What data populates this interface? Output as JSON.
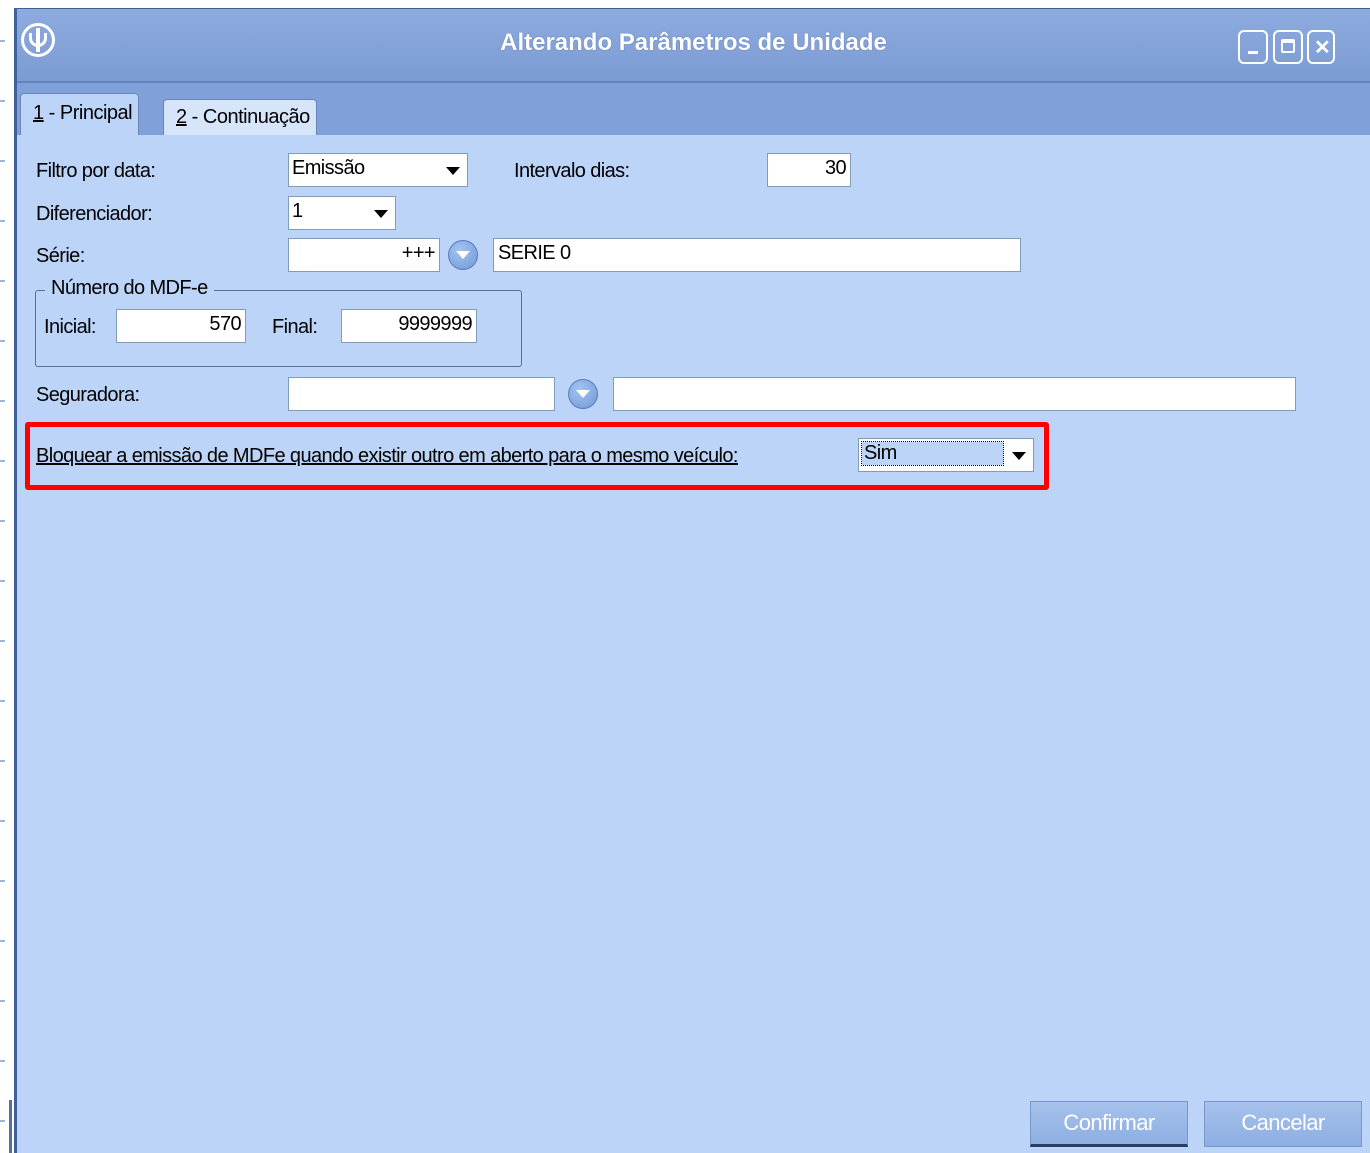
{
  "window": {
    "title": "Alterando Parâmetros de Unidade"
  },
  "tabs": [
    {
      "key": "1",
      "label": " - Principal"
    },
    {
      "key": "2",
      "label": " - Continuação"
    }
  ],
  "form": {
    "filtro_label": "Filtro por data:",
    "filtro_value": "Emissão",
    "intervalo_label": "Intervalo dias:",
    "intervalo_value": "30",
    "diferenciador_label": "Diferenciador:",
    "diferenciador_value": "1",
    "serie_label": "Série:",
    "serie_code": "+++",
    "serie_desc": "SERIE 0",
    "numero_group_title": "Número do MDF-e",
    "inicial_label": "Inicial:",
    "inicial_value": "570",
    "final_label": "Final:",
    "final_value": "9999999",
    "seguradora_label": "Seguradora:",
    "seguradora_code": "",
    "seguradora_desc": "",
    "bloquear_label": "Bloquear a emissão de MDFe quando existir outro em aberto para o mesmo veículo:",
    "bloquear_value": "Sim"
  },
  "buttons": {
    "confirm_label": "Confirmar",
    "cancel_label": "Cancelar"
  },
  "colors": {
    "highlight": "#ff0000",
    "titlebar": "#7c9bd3",
    "client": "#bcd4f7"
  }
}
